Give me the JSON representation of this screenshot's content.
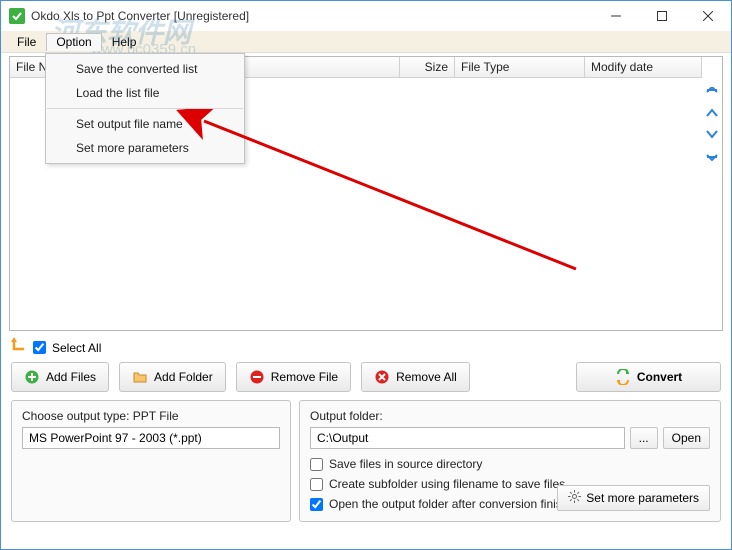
{
  "window": {
    "title": "Okdo Xls to Ppt Converter [Unregistered]"
  },
  "menubar": {
    "file": "File",
    "option": "Option",
    "help": "Help"
  },
  "dropdown": {
    "save_list": "Save the converted list",
    "load_list": "Load the list file",
    "set_output_name": "Set output file name",
    "set_more_params": "Set more parameters"
  },
  "columns": {
    "filename": "File Name",
    "size": "Size",
    "filetype": "File Type",
    "modify": "Modify date"
  },
  "mid": {
    "select_all": "Select All"
  },
  "buttons": {
    "add_files": "Add Files",
    "add_folder": "Add Folder",
    "remove_file": "Remove File",
    "remove_all": "Remove All",
    "convert": "Convert"
  },
  "output_type": {
    "label": "Choose output type:  PPT File",
    "value": "MS PowerPoint 97 - 2003 (*.ppt)"
  },
  "output_folder": {
    "label": "Output folder:",
    "value": "C:\\Output",
    "browse": "...",
    "open": "Open"
  },
  "options": {
    "save_in_source": "Save files in source directory",
    "create_subfolder": "Create subfolder using filename to save files",
    "open_after": "Open the output folder after conversion finished"
  },
  "more_params": "Set more parameters",
  "colors": {
    "accent": "#2a82da",
    "green": "#3cb043",
    "orange": "#f89b1c",
    "red": "#d22"
  },
  "watermark": {
    "line1": "河东软件网",
    "line2": "www.pc0359.cn"
  }
}
